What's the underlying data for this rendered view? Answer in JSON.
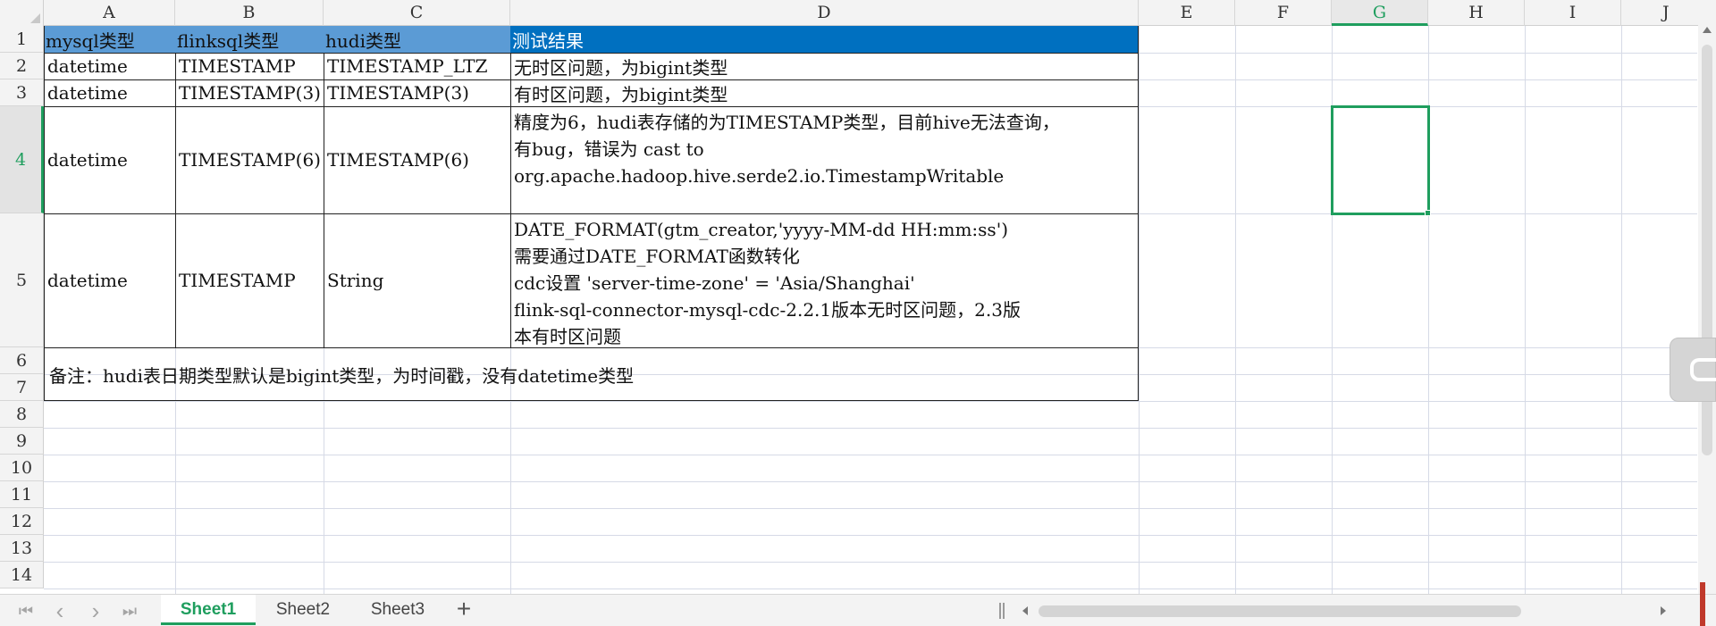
{
  "columns": [
    "A",
    "B",
    "C",
    "D",
    "E",
    "F",
    "G",
    "H",
    "I",
    "J"
  ],
  "selected_column": "G",
  "rows": [
    "1",
    "2",
    "3",
    "4",
    "5",
    "6",
    "7",
    "8",
    "9",
    "10",
    "11",
    "12",
    "13",
    "14"
  ],
  "selected_row": "4",
  "header": {
    "a": "mysql类型",
    "b": "flinksql类型",
    "c": "hudi类型",
    "d": "测试结果"
  },
  "table_rows": [
    {
      "a": "datetime",
      "b": "TIMESTAMP",
      "c": "TIMESTAMP_LTZ",
      "d": "无时区问题，为bigint类型"
    },
    {
      "a": "datetime",
      "b": "TIMESTAMP(3)",
      "c": "TIMESTAMP(3)",
      "d": "有时区问题，为bigint类型"
    },
    {
      "a": "datetime",
      "b": "TIMESTAMP(6)",
      "c": "TIMESTAMP(6)",
      "d_lines": [
        "精度为6，hudi表存储的为TIMESTAMP类型，目前hive无法查询，",
        "有bug，错误为 cast to",
        "org.apache.hadoop.hive.serde2.io.TimestampWritable"
      ]
    },
    {
      "a": "datetime",
      "b": "TIMESTAMP",
      "c": "String",
      "d_lines": [
        "DATE_FORMAT(gtm_creator,'yyyy-MM-dd HH:mm:ss')",
        "需要通过DATE_FORMAT函数转化",
        "cdc设置 'server-time-zone' = 'Asia/Shanghai'",
        "flink-sql-connector-mysql-cdc-2.2.1版本无时区问题，2.3版",
        "本有时区问题"
      ]
    }
  ],
  "note": "备注：hudi表日期类型默认是bigint类型，为时间戳，没有datetime类型",
  "colors": {
    "header_light": "#5b9bd5",
    "header_dark": "#0070c0",
    "selection": "#1f9e5e"
  },
  "sheet_tabs": [
    "Sheet1",
    "Sheet2",
    "Sheet3"
  ],
  "active_sheet": "Sheet1",
  "icons": {
    "nav_first": "⏮",
    "nav_prev": "‹",
    "nav_next": "›",
    "nav_last": "⏭",
    "add_sheet": "+"
  }
}
